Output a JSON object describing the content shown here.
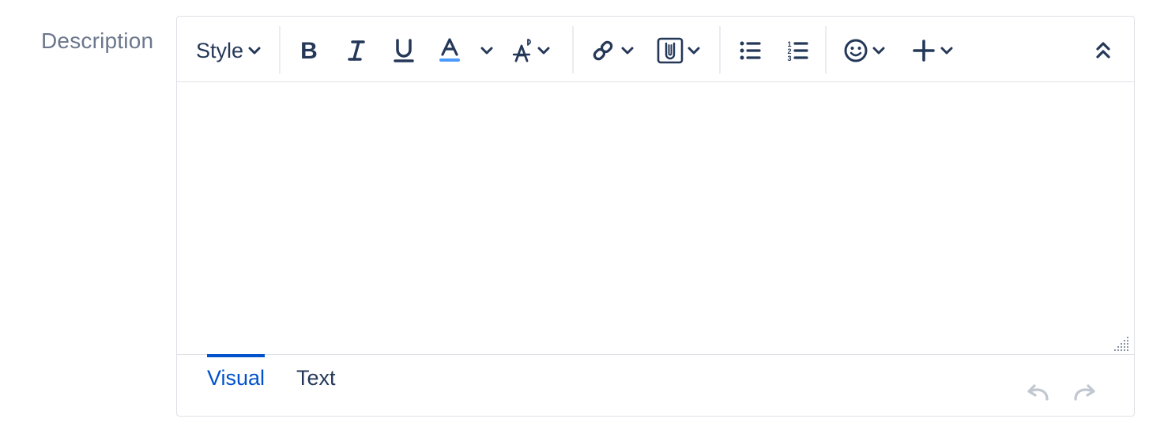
{
  "field": {
    "label": "Description"
  },
  "toolbar": {
    "style_label": "Style",
    "icons": {
      "bold": "bold-icon",
      "italic": "italic-icon",
      "underline": "underline-icon",
      "text_color": "text-color-icon",
      "more_formatting": "more-formatting-icon",
      "link": "link-icon",
      "attachment": "attachment-icon",
      "bullet_list": "bullet-list-icon",
      "numbered_list": "numbered-list-icon",
      "emoji": "emoji-icon",
      "insert": "plus-icon",
      "collapse": "collapse-toolbar-icon"
    }
  },
  "editor": {
    "content": ""
  },
  "footer": {
    "tabs": [
      {
        "label": "Visual",
        "active": true
      },
      {
        "label": "Text",
        "active": false
      }
    ],
    "undo_icon": "undo-icon",
    "redo_icon": "redo-icon"
  },
  "colors": {
    "icon": "#253858",
    "accent": "#0052cc",
    "text_color_bar": "#4c9aff",
    "label": "#6b778c",
    "disabled": "#c1c7d0"
  }
}
